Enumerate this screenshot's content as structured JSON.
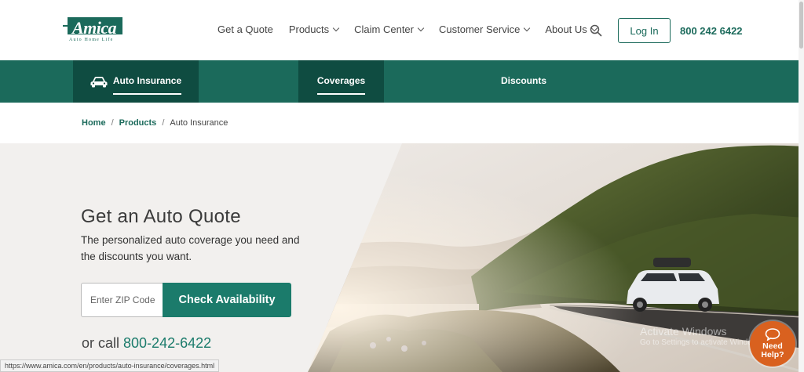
{
  "header": {
    "logo": {
      "name": "Amica",
      "tagline": "Auto  Home  Life"
    },
    "nav": [
      {
        "label": "Get a Quote",
        "has_dropdown": false
      },
      {
        "label": "Products",
        "has_dropdown": true
      },
      {
        "label": "Claim Center",
        "has_dropdown": true
      },
      {
        "label": "Customer Service",
        "has_dropdown": true
      },
      {
        "label": "About Us",
        "has_dropdown": true
      }
    ],
    "search_icon": "search-icon",
    "login_label": "Log In",
    "phone": "800 242 6422"
  },
  "subnav": {
    "items": [
      {
        "label": "Auto Insurance",
        "icon": "car-icon"
      },
      {
        "label": "Coverages"
      },
      {
        "label": "Discounts"
      }
    ]
  },
  "breadcrumb": {
    "items": [
      "Home",
      "Products",
      "Auto Insurance"
    ]
  },
  "hero": {
    "title": "Get an Auto Quote",
    "subtitle": "The personalized auto coverage you need and the discounts you want.",
    "zip_placeholder": "Enter ZIP Code",
    "check_label": "Check Availability",
    "or_call_prefix": "or call",
    "call_number": "800-242-6422"
  },
  "status_bar": {
    "url": "https://www.amica.com/en/products/auto-insurance/coverages.html"
  },
  "watermark": {
    "line1": "Activate Windows",
    "line2": "Go to Settings to activate Windows."
  },
  "help_bubble": {
    "line1": "Need",
    "line2": "Help?"
  },
  "colors": {
    "brand_green": "#1b6a5b",
    "dark_green": "#0f4c41",
    "button_green": "#1b7b6b",
    "help_orange": "#d9611f"
  }
}
